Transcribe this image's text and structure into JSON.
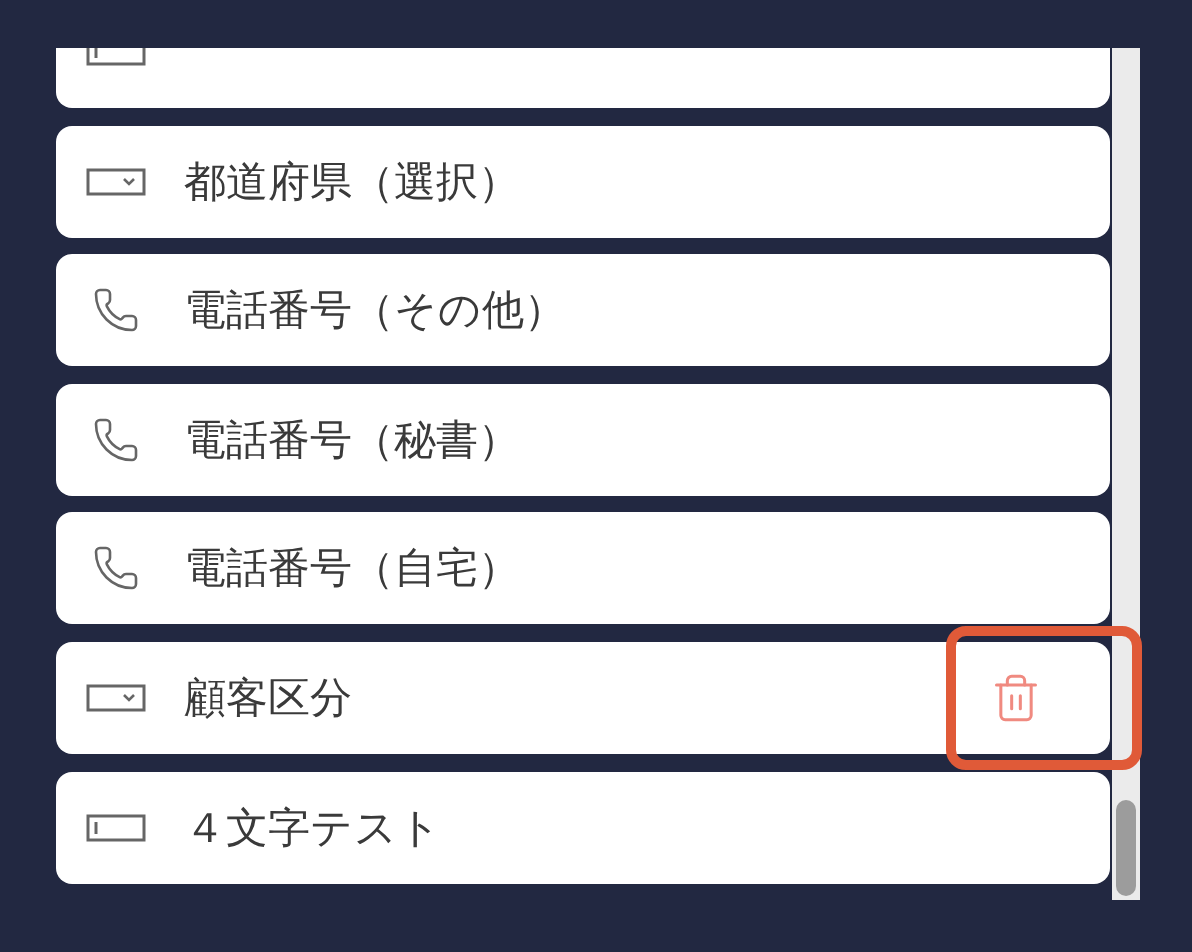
{
  "fields": [
    {
      "kind": "text",
      "hovered": false
    },
    {
      "kind": "select",
      "label": "都道府県（選択）",
      "hovered": false
    },
    {
      "kind": "phone",
      "label": "電話番号（その他）",
      "hovered": false
    },
    {
      "kind": "phone",
      "label": "電話番号（秘書）",
      "hovered": false
    },
    {
      "kind": "phone",
      "label": "電話番号（自宅）",
      "hovered": false
    },
    {
      "kind": "select",
      "label": "顧客区分",
      "hovered": true
    },
    {
      "kind": "text",
      "label": "４文字テスト",
      "hovered": false
    }
  ]
}
